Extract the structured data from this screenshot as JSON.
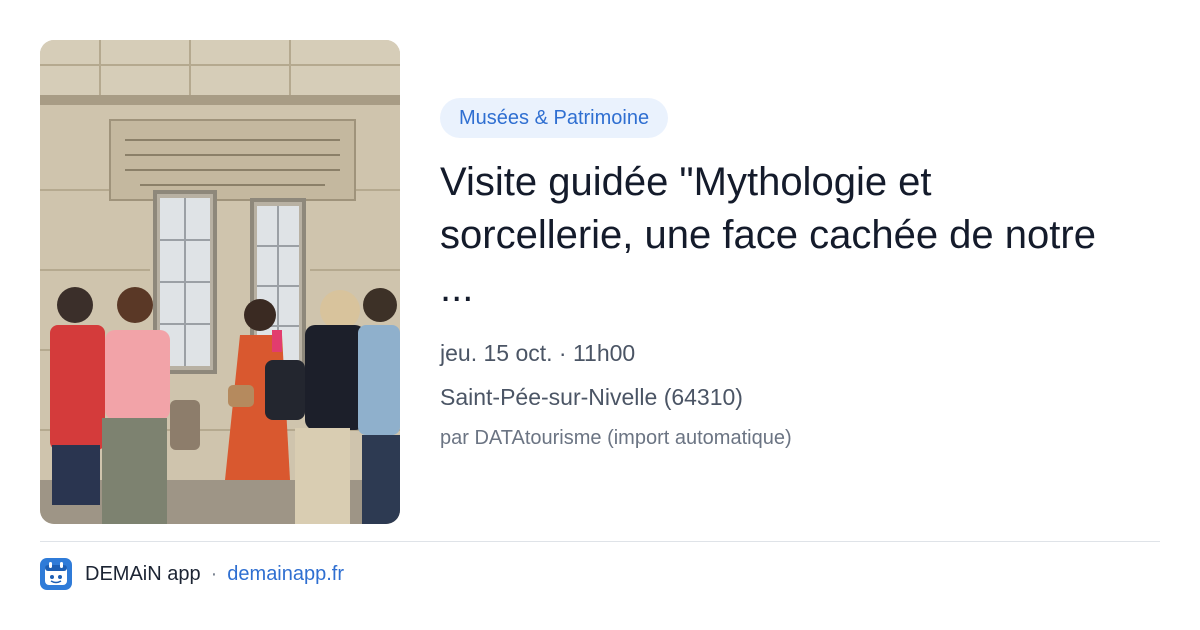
{
  "event": {
    "category": "Musées & Patrimoine",
    "title": "Visite guidée \"Mythologie et sorcellerie, une face cachée de notre ...",
    "datetime": "jeu. 15 oct. · 11h00",
    "location": "Saint-Pée-sur-Nivelle (64310)",
    "source": "par DATAtourisme (import automatique)",
    "image_alt": "Guided tour group in front of a stone building"
  },
  "footer": {
    "app_name": "DEMAiN app",
    "separator": "·",
    "app_url": "demainapp.fr",
    "icon": "demain-app-icon"
  },
  "colors": {
    "badge_bg": "#eaf2fd",
    "badge_text": "#2f6fd1",
    "link": "#2f6fd1",
    "title": "#141b2b",
    "meta": "#4b5565"
  }
}
